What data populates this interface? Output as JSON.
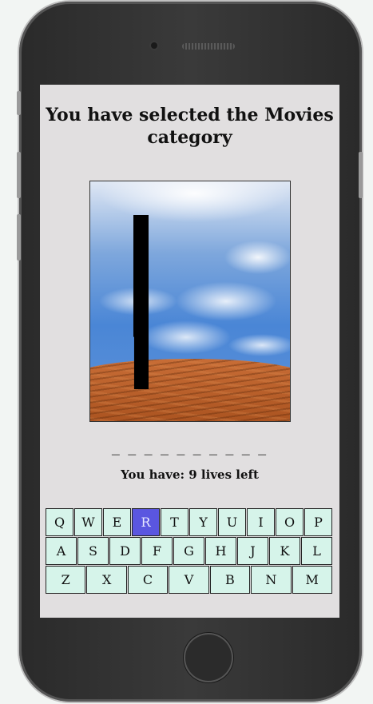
{
  "header": {
    "line1": "You have selected the Movies",
    "line2": "category"
  },
  "word_blanks": "_ _ _ _ _ _ _ _ _ _",
  "lives_text": "You have: 9 lives left",
  "keyboard": {
    "rows": [
      [
        "Q",
        "W",
        "E",
        "R",
        "T",
        "Y",
        "U",
        "I",
        "O",
        "P"
      ],
      [
        "A",
        "S",
        "D",
        "F",
        "G",
        "H",
        "J",
        "K",
        "L"
      ],
      [
        "Z",
        "X",
        "C",
        "V",
        "B",
        "N",
        "M"
      ]
    ],
    "used": [
      "R"
    ],
    "colors": {
      "key": "#d6f4ea",
      "used_key": "#5a56e0"
    }
  }
}
